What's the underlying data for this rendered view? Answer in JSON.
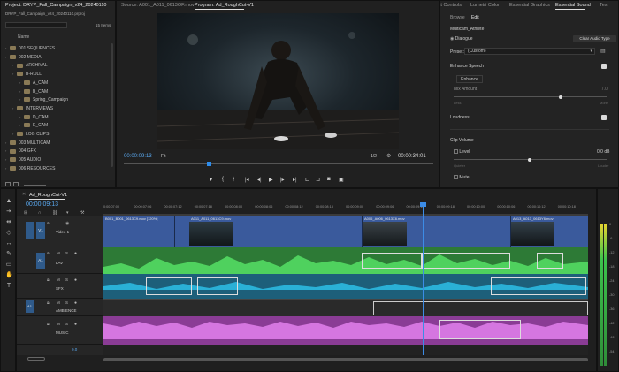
{
  "project": {
    "tab": "Project: DRYP_Fall_Campaign_v24_20240110",
    "file": "DRYP_Fall_Campaign_v24_20240110.prproj",
    "count": "15 Items",
    "column": "Name",
    "bins": [
      {
        "label": "001 SEQUENCES",
        "indent": 0
      },
      {
        "label": "002 MEDIA",
        "indent": 0
      },
      {
        "label": "ARCHIVAL",
        "indent": 1
      },
      {
        "label": "B-ROLL",
        "indent": 1
      },
      {
        "label": "A_CAM",
        "indent": 2
      },
      {
        "label": "B_CAM",
        "indent": 2
      },
      {
        "label": "Spring_Campaign",
        "indent": 2
      },
      {
        "label": "INTERVIEWS",
        "indent": 1
      },
      {
        "label": "D_CAM",
        "indent": 2
      },
      {
        "label": "E_CAM",
        "indent": 2
      },
      {
        "label": "LOG CLIPS",
        "indent": 1
      },
      {
        "label": "003 MULTICAM",
        "indent": 0
      },
      {
        "label": "004 GFX",
        "indent": 0
      },
      {
        "label": "005 AUDIO",
        "indent": 0
      },
      {
        "label": "006 RESOURCES",
        "indent": 0
      }
    ]
  },
  "monitor": {
    "source_tab": "Source: A001_A011_0613OF.mov",
    "program_tab": "Program: Ad_RoughCut-V1",
    "timecode": "00:00:09:13",
    "fit": "Fit",
    "quality": "1/2",
    "duration": "00:00:34:01"
  },
  "essential": {
    "tabs": [
      "Effect Controls",
      "Lumetri Color",
      "Essential Graphics",
      "Essential Sound",
      "Text"
    ],
    "subtabs": [
      "Browse",
      "Edit"
    ],
    "clip_name": "Multicam_Athlete",
    "type": "Dialogue",
    "clear": "Clear Audio Type",
    "preset_label": "Preset:",
    "preset_value": "(Custom)",
    "enhance_section": "Enhance Speech",
    "enhance_btn": "Enhance",
    "mix_amount": "Mix Amount",
    "mix_value": "7.0",
    "less": "Less",
    "more": "More",
    "loudness": "Loudness",
    "clip_volume": "Clip Volume",
    "level": "Level",
    "level_value": "0.0 dB",
    "quieter": "Quieter",
    "louder": "Louder",
    "mute": "Mute"
  },
  "timeline": {
    "tab": "Ad_RoughCut-V1",
    "timecode": "00:00:09:13",
    "ruler": [
      "0:00:07:00",
      "00:00:07:06",
      "00:00:07:12",
      "00:00:07:18",
      "00:00:08:00",
      "00:00:08:06",
      "00:00:08:12",
      "00:00:08:18",
      "00:00:09:00",
      "00:00:09:06",
      "00:00:09:12",
      "00:00:09:18",
      "00:00:10:00",
      "00:00:10:06",
      "00:00:10:12",
      "00:00:10:18"
    ],
    "tracks": {
      "v1": {
        "name": "Video 1",
        "code": "V1"
      },
      "a1": {
        "name": "LAV",
        "code": "A1"
      },
      "a2": {
        "name": "SFX",
        "code": "A2"
      },
      "a3": {
        "name": "AMBIENCE",
        "code": "A3"
      },
      "a4": {
        "name": "MUSIC",
        "code": "A4"
      }
    },
    "clips": {
      "v1": "B001_B001_0613C9.mov [120%]",
      "v2": "A011_A011_0613C9.mov",
      "v3": "A006_A006_0613X6.mov",
      "v4": "A013_A013_0613Y6.mov"
    },
    "master_value": "0.0"
  },
  "meters": [
    "0",
    "-6",
    "-12",
    "-18",
    "-24",
    "-30",
    "-36",
    "-42",
    "-48",
    "-54"
  ],
  "colors": {
    "accent": "#2d8ceb",
    "video_clip": "#3a5a9c",
    "audio_green": "#3fbd4f",
    "audio_cyan": "#2aa6c9",
    "audio_purple": "#c35ad0"
  }
}
